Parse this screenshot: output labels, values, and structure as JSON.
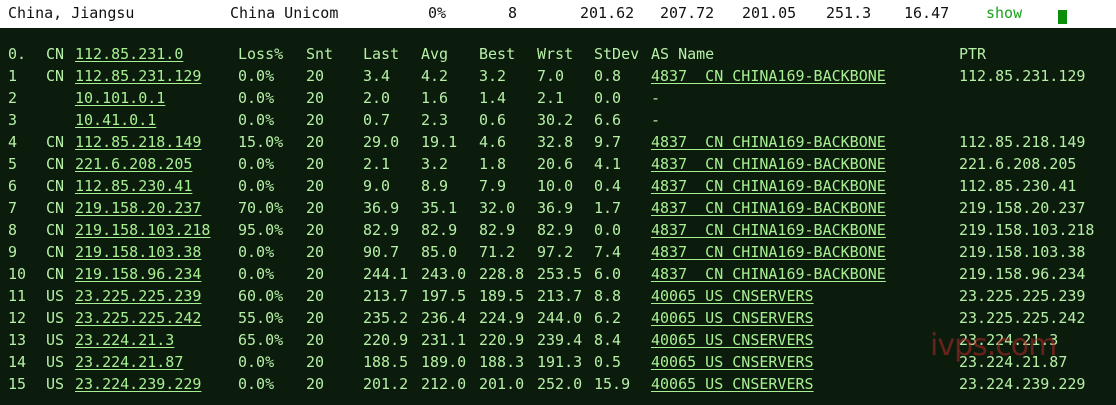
{
  "header": {
    "location": "China, Jiangsu",
    "isp": "China Unicom",
    "loss": "0%",
    "sent": "8",
    "v1": "201.62",
    "v2": "207.72",
    "v3": "201.05",
    "v4": "251.3",
    "v5": "16.47",
    "show": "show"
  },
  "columns": {
    "hop": "0.",
    "cc": "CN",
    "ip": "112.85.231.0",
    "loss": "Loss%",
    "snt": "Snt",
    "last": "Last",
    "avg": "Avg",
    "best": "Best",
    "wrst": "Wrst",
    "stdev": "StDev",
    "as": "AS Name",
    "ptr": "PTR"
  },
  "rows": [
    {
      "hop": "1",
      "cc": "CN",
      "ip": "112.85.231.129",
      "loss": "0.0%",
      "snt": "20",
      "last": "3.4",
      "avg": "4.2",
      "best": "3.2",
      "wrst": "7.0",
      "stdev": "0.8",
      "as": "4837  CN CHINA169-BACKBONE",
      "ptr": "112.85.231.129"
    },
    {
      "hop": "2",
      "cc": "",
      "ip": "10.101.0.1",
      "loss": "0.0%",
      "snt": "20",
      "last": "2.0",
      "avg": "1.6",
      "best": "1.4",
      "wrst": "2.1",
      "stdev": "0.0",
      "as": "-",
      "ptr": ""
    },
    {
      "hop": "3",
      "cc": "",
      "ip": "10.41.0.1",
      "loss": "0.0%",
      "snt": "20",
      "last": "0.7",
      "avg": "2.3",
      "best": "0.6",
      "wrst": "30.2",
      "stdev": "6.6",
      "as": "-",
      "ptr": ""
    },
    {
      "hop": "4",
      "cc": "CN",
      "ip": "112.85.218.149",
      "loss": "15.0%",
      "snt": "20",
      "last": "29.0",
      "avg": "19.1",
      "best": "4.6",
      "wrst": "32.8",
      "stdev": "9.7",
      "as": "4837  CN CHINA169-BACKBONE",
      "ptr": "112.85.218.149"
    },
    {
      "hop": "5",
      "cc": "CN",
      "ip": "221.6.208.205",
      "loss": "0.0%",
      "snt": "20",
      "last": "2.1",
      "avg": "3.2",
      "best": "1.8",
      "wrst": "20.6",
      "stdev": "4.1",
      "as": "4837  CN CHINA169-BACKBONE",
      "ptr": "221.6.208.205"
    },
    {
      "hop": "6",
      "cc": "CN",
      "ip": "112.85.230.41",
      "loss": "0.0%",
      "snt": "20",
      "last": "9.0",
      "avg": "8.9",
      "best": "7.9",
      "wrst": "10.0",
      "stdev": "0.4",
      "as": "4837  CN CHINA169-BACKBONE",
      "ptr": "112.85.230.41"
    },
    {
      "hop": "7",
      "cc": "CN",
      "ip": "219.158.20.237",
      "loss": "70.0%",
      "snt": "20",
      "last": "36.9",
      "avg": "35.1",
      "best": "32.0",
      "wrst": "36.9",
      "stdev": "1.7",
      "as": "4837  CN CHINA169-BACKBONE",
      "ptr": "219.158.20.237"
    },
    {
      "hop": "8",
      "cc": "CN",
      "ip": "219.158.103.218",
      "loss": "95.0%",
      "snt": "20",
      "last": "82.9",
      "avg": "82.9",
      "best": "82.9",
      "wrst": "82.9",
      "stdev": "0.0",
      "as": "4837  CN CHINA169-BACKBONE",
      "ptr": "219.158.103.218"
    },
    {
      "hop": "9",
      "cc": "CN",
      "ip": "219.158.103.38",
      "loss": "0.0%",
      "snt": "20",
      "last": "90.7",
      "avg": "85.0",
      "best": "71.2",
      "wrst": "97.2",
      "stdev": "7.4",
      "as": "4837  CN CHINA169-BACKBONE",
      "ptr": "219.158.103.38"
    },
    {
      "hop": "10",
      "cc": "CN",
      "ip": "219.158.96.234",
      "loss": "0.0%",
      "snt": "20",
      "last": "244.1",
      "avg": "243.0",
      "best": "228.8",
      "wrst": "253.5",
      "stdev": "6.0",
      "as": "4837  CN CHINA169-BACKBONE",
      "ptr": "219.158.96.234"
    },
    {
      "hop": "11",
      "cc": "US",
      "ip": "23.225.225.239",
      "loss": "60.0%",
      "snt": "20",
      "last": "213.7",
      "avg": "197.5",
      "best": "189.5",
      "wrst": "213.7",
      "stdev": "8.8",
      "as": "40065 US CNSERVERS",
      "ptr": "23.225.225.239"
    },
    {
      "hop": "12",
      "cc": "US",
      "ip": "23.225.225.242",
      "loss": "55.0%",
      "snt": "20",
      "last": "235.2",
      "avg": "236.4",
      "best": "224.9",
      "wrst": "244.0",
      "stdev": "6.2",
      "as": "40065 US CNSERVERS",
      "ptr": "23.225.225.242"
    },
    {
      "hop": "13",
      "cc": "US",
      "ip": "23.224.21.3",
      "loss": "65.0%",
      "snt": "20",
      "last": "220.9",
      "avg": "231.1",
      "best": "220.9",
      "wrst": "239.4",
      "stdev": "8.4",
      "as": "40065 US CNSERVERS",
      "ptr": "23.224.21.3"
    },
    {
      "hop": "14",
      "cc": "US",
      "ip": "23.224.21.87",
      "loss": "0.0%",
      "snt": "20",
      "last": "188.5",
      "avg": "189.0",
      "best": "188.3",
      "wrst": "191.3",
      "stdev": "0.5",
      "as": "40065 US CNSERVERS",
      "ptr": "23.224.21.87"
    },
    {
      "hop": "15",
      "cc": "US",
      "ip": "23.224.239.229",
      "loss": "0.0%",
      "snt": "20",
      "last": "201.2",
      "avg": "212.0",
      "best": "201.0",
      "wrst": "252.0",
      "stdev": "15.9",
      "as": "40065 US CNSERVERS",
      "ptr": "23.224.239.229"
    }
  ],
  "watermark": "ivps.com"
}
